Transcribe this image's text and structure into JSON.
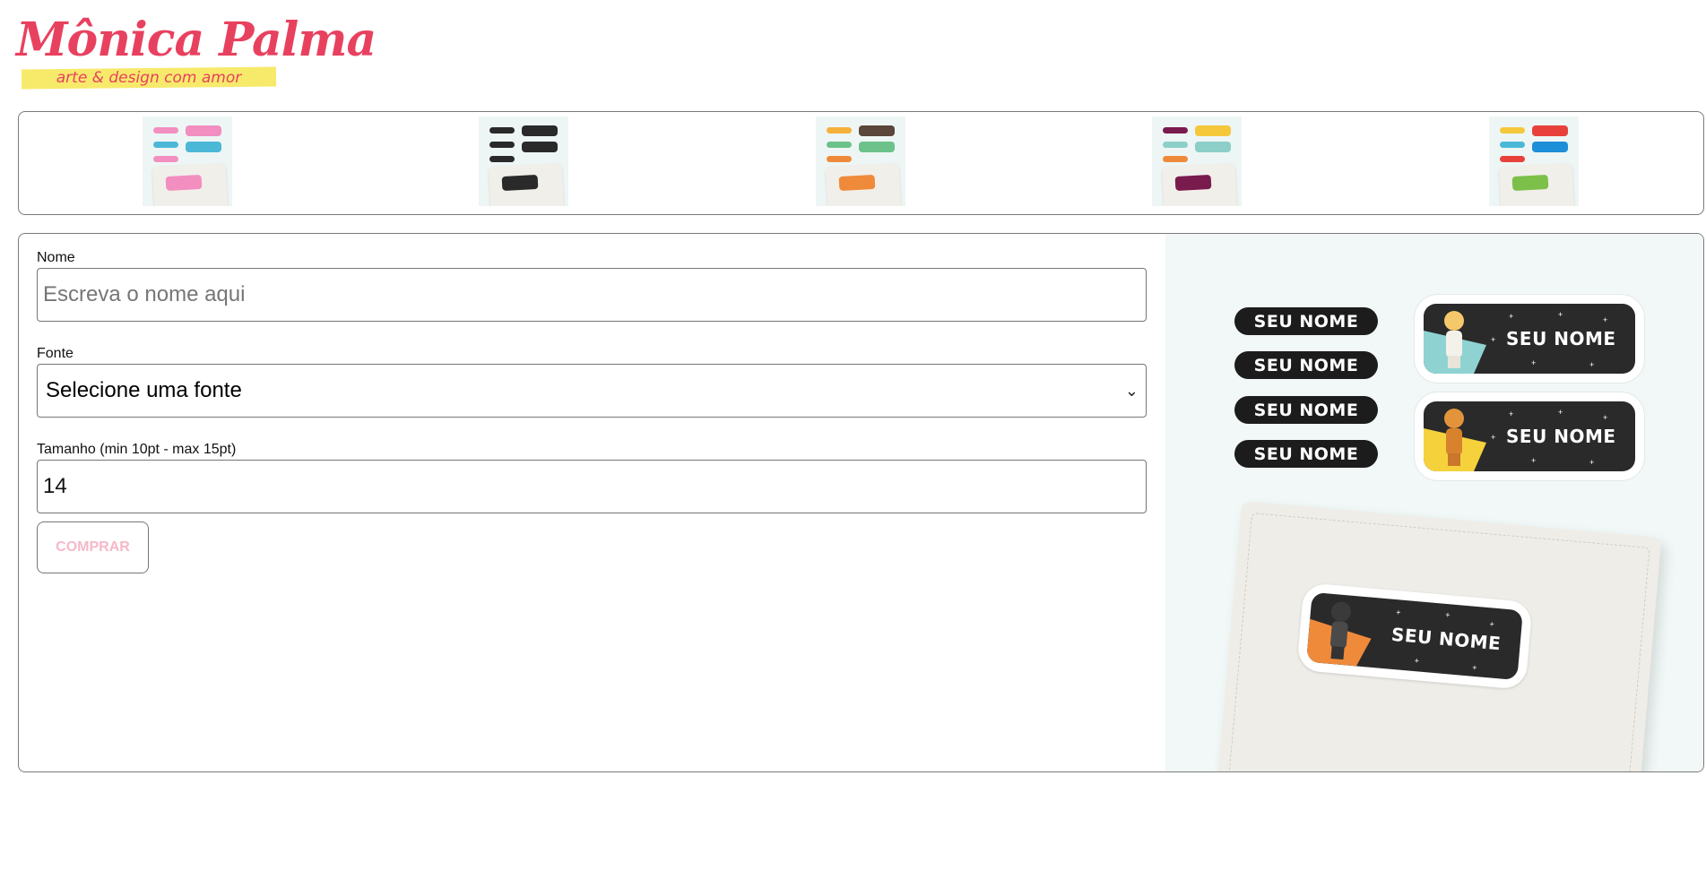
{
  "brand": {
    "name": "Mônica Palma",
    "tagline": "arte & design com amor",
    "colors": {
      "primary": "#e8415f",
      "highlight": "#f7ea6b"
    }
  },
  "thumbnails": [
    {
      "name": "pink-blue-theme",
      "tag_color": "#f28fc0",
      "rows": [
        "#f28fc0",
        "#4cb8d8",
        "#f28fc0"
      ],
      "chips": [
        "#f28fc0",
        "#4cb8d8"
      ]
    },
    {
      "name": "black-theme",
      "tag_color": "#2a2a2a",
      "rows": [
        "#2a2a2a",
        "#2a2a2a",
        "#2a2a2a"
      ],
      "chips": [
        "#2a2a2a",
        "#2a2a2a"
      ]
    },
    {
      "name": "orange-green-theme",
      "tag_color": "#f08a3b",
      "rows": [
        "#f5b13b",
        "#6cc28a",
        "#f08a3b"
      ],
      "chips": [
        "#5a463a",
        "#6cc28a"
      ]
    },
    {
      "name": "purple-yellow-theme",
      "tag_color": "#7a1b4d",
      "rows": [
        "#7a1b4d",
        "#8ccfc8",
        "#f08a3b"
      ],
      "chips": [
        "#f5c83b",
        "#8ccfc8"
      ]
    },
    {
      "name": "multicolor-theme",
      "tag_color": "#7cc04a",
      "rows": [
        "#f5c83b",
        "#4cb8d8",
        "#e8413b"
      ],
      "chips": [
        "#e8413b",
        "#1c8fd8"
      ]
    }
  ],
  "form": {
    "name": {
      "label": "Nome",
      "placeholder": "Escreva o nome aqui",
      "value": ""
    },
    "font": {
      "label": "Fonte",
      "selected": "Selecione uma fonte"
    },
    "size": {
      "label": "Tamanho (min 10pt - max 15pt)",
      "value": "14"
    },
    "buy_label": "COMPRAR"
  },
  "preview": {
    "small_labels": [
      "SEU NOME",
      "SEU NOME",
      "SEU NOME",
      "SEU NOME"
    ],
    "big_labels": [
      {
        "text": "SEU NOME",
        "corner_color": "#8ed3d2",
        "character": "luke-skywalker"
      },
      {
        "text": "SEU NOME",
        "corner_color": "#f5d23b",
        "character": "c3po"
      }
    ],
    "notebook_label": {
      "text": "SEU NOME",
      "corner_color": "#f08a3b",
      "character": "darth-vader"
    }
  }
}
